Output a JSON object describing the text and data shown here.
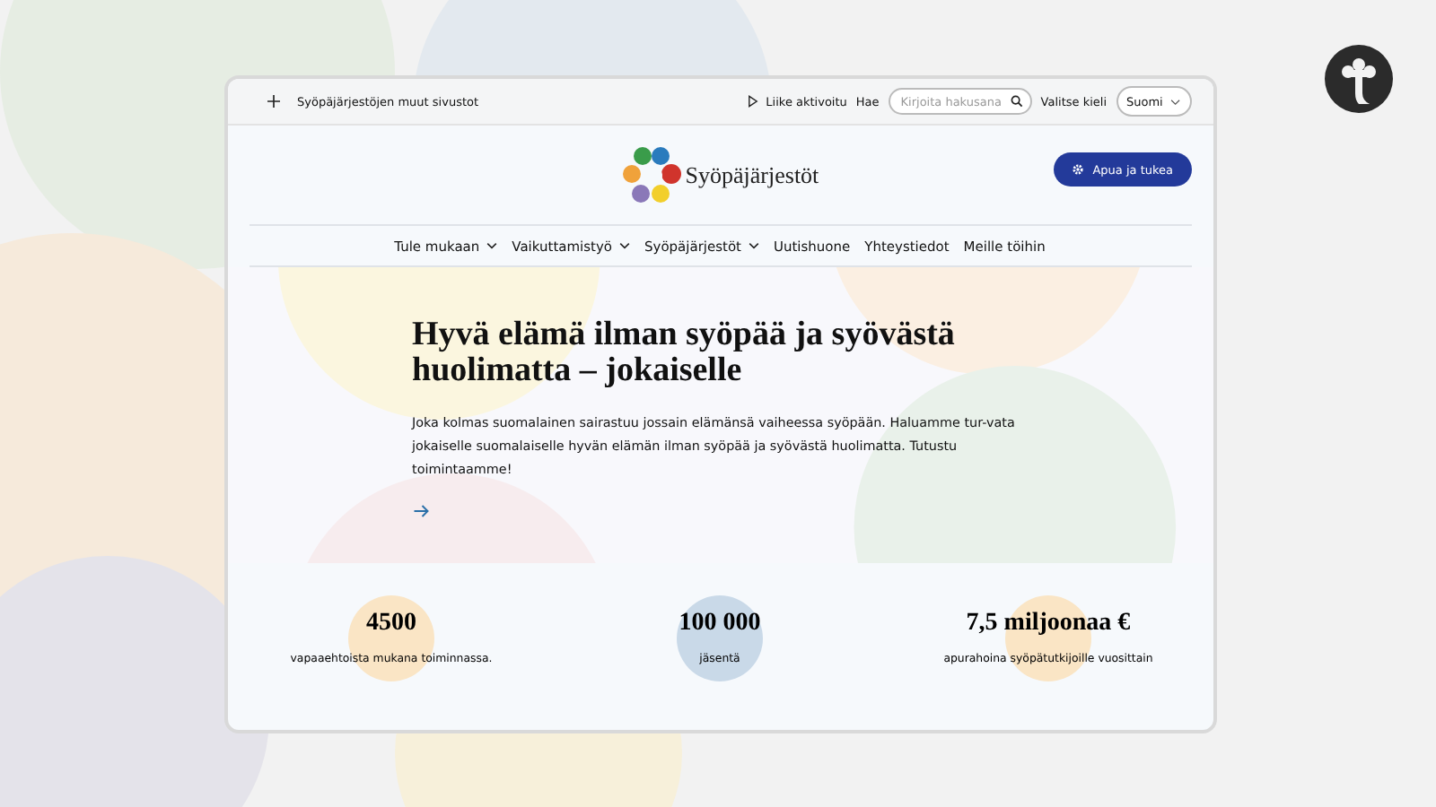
{
  "top_bar": {
    "other_sites": "Syöpäjärjestöjen muut sivustot",
    "motion": "Liike aktivoitu",
    "search_label": "Hae",
    "search_placeholder": "Kirjoita hakusana",
    "language_label": "Valitse kieli",
    "language": "Suomi"
  },
  "header": {
    "logo_text": "Syöpäjärjestöt",
    "help_button": "Apua ja tukea"
  },
  "nav": [
    {
      "label": "Tule mukaan",
      "dropdown": true
    },
    {
      "label": "Vaikuttamistyö",
      "dropdown": true
    },
    {
      "label": "Syöpäjärjestöt",
      "dropdown": true
    },
    {
      "label": "Uutishuone",
      "dropdown": false
    },
    {
      "label": "Yhteystiedot",
      "dropdown": false
    },
    {
      "label": "Meille töihin",
      "dropdown": false
    }
  ],
  "hero": {
    "title": "Hyvä elämä ilman syöpää ja syövästä huolimatta – jokaiselle",
    "text": "Joka kolmas suomalainen sairastuu jossain elämänsä vaiheessa syöpään. Haluamme tur-vata jokaiselle suomalaiselle hyvän elämän ilman syöpää ja syövästä huolimatta. Tutustu toimintaamme!"
  },
  "stats": [
    {
      "value": "4500",
      "label": "vapaaehtoista mukana toiminnassa.",
      "color": "#fae5c5"
    },
    {
      "value": "100 000",
      "label": "jäsentä",
      "color": "#c9d9e8"
    },
    {
      "value": "7,5 miljoonaa €",
      "label": "apurahoina syöpätutkijoille vuosittain",
      "color": "#fae5c5"
    }
  ]
}
